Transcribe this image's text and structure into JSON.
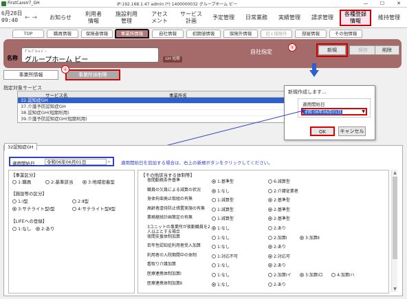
{
  "window": {
    "app_name": "FirstCareV7_GH",
    "title": "IP:192.168.1.47 admin (*) 1400000032 グループホーム ビー",
    "min": "—",
    "max": "☐",
    "close": "✕"
  },
  "topnav": {
    "date_line1": "6月28日",
    "date_line2": "09:40",
    "back": "←",
    "forward": "→",
    "items": [
      {
        "label": "お知らせ"
      },
      {
        "label": "利用者\n情報"
      },
      {
        "label": "施設利用\n管理"
      },
      {
        "label": "アセス\nメント"
      },
      {
        "label": "サービス\n計画"
      },
      {
        "label": "予定管理"
      },
      {
        "label": "日常業務"
      },
      {
        "label": "実績管理"
      },
      {
        "label": "請求管理"
      },
      {
        "label": "各種登録\n情報"
      },
      {
        "label": "維持管理"
      }
    ]
  },
  "tabs": [
    {
      "label": "TOP"
    },
    {
      "label": "職員情報"
    },
    {
      "label": "保険者情報"
    },
    {
      "label": "事業所情報"
    },
    {
      "label": "自社情報"
    },
    {
      "label": "初期値情報"
    },
    {
      "label": "保険外情報"
    },
    {
      "label": "旧↓保険外"
    },
    {
      "label": "部屋情報"
    },
    {
      "label": "その他情報"
    }
  ],
  "header": {
    "name_label": "名称",
    "kana": "ｸﾞﾙｰﾌﾟﾎｰﾑ ﾋﾞｰ",
    "facility_name": "グループホーム ビー",
    "badge": "GH 短期",
    "own_company": "自社指定",
    "new_button": "新規",
    "save_button": "保存",
    "delete_button": "削除"
  },
  "annotations": {
    "one": "①",
    "two": "②"
  },
  "subtabs": {
    "office_info": "事業所情報",
    "office_system": "事業所体制等"
  },
  "service": {
    "caption": "指定対象サービス",
    "col_service": "サービス名",
    "col_office": "事業所名",
    "rows": [
      {
        "label": "32.認知症GH"
      },
      {
        "label": "37.介護予防認知症GH"
      },
      {
        "label": "38.認知症GH(短期利用)"
      },
      {
        "label": "39.介護予防認知症GH(短期利用)"
      }
    ]
  },
  "dialog": {
    "title": "新規作成します...",
    "start_date_label": "適用開始日",
    "start_date_value": "令和 06年06月01日",
    "ok": "OK",
    "cancel": "キャンセル"
  },
  "lower": {
    "tab": "32認知症GH",
    "start_label": "適用開始日",
    "start_value": "令和06年06月01日",
    "notice": "適用開始日を追加する場合は、右上の新規ボタンをクリックしてください。",
    "region": {
      "title": "【事業区分】",
      "options": [
        "1:職員",
        "2:基準該当",
        "3:地域密着型"
      ],
      "selected": 2
    },
    "facility": {
      "title": "【施設等の区分】",
      "options": [
        "1:Ⅰ型",
        "2:Ⅱ型",
        "3:サテライト型Ⅰ型",
        "4:サテライト型Ⅱ型"
      ],
      "selected": 2
    },
    "life": {
      "title": "【LIFEへの登録】",
      "options": [
        "1:なし",
        "2:あり"
      ],
      "selected": 1
    },
    "other": {
      "title": "【その他該当する体制等】",
      "rows": [
        {
          "label": "夜間勤務条件基準",
          "opts": [
            "1:基準型",
            "6:減算型"
          ],
          "sel": 0
        },
        {
          "label": "職員の欠員による減算の状況",
          "opts": [
            "1:なし",
            "2:介護従業者"
          ],
          "sel": 0
        },
        {
          "label": "身体拘束廃止取組の有無",
          "opts": [
            "1:減算型",
            "2:基準型"
          ],
          "sel": 1
        },
        {
          "label": "高齢者虐待防止措置実施の有無",
          "opts": [
            "1:減算型",
            "2:基準型"
          ],
          "sel": 1
        },
        {
          "label": "業務継続計画策定の有無",
          "opts": [
            "1:減算型",
            "2:基準型"
          ],
          "sel": 1
        },
        {
          "label": "3ユニットの事業所が夜勤職員を2人以上とする場合",
          "opts": [
            "1:なし",
            "2:あり"
          ],
          "sel": 0
        },
        {
          "label": "夜間支援体制加算",
          "opts": [
            "1:なし",
            "2:加算Ⅰ",
            "3:加算Ⅱ"
          ],
          "sel": 2
        },
        {
          "label": "若年性認知症利用者受入加算",
          "opts": [
            "1:なし",
            "2:あり"
          ],
          "sel": 1
        },
        {
          "label": "利用者の入院期間中の体制",
          "opts": [
            "1:対応不可",
            "2:対応可"
          ],
          "sel": 1
        },
        {
          "label": "看取り介護加算",
          "opts": [
            "1:なし",
            "2:あり"
          ],
          "sel": 1
        },
        {
          "label": "医療連携体制加算Ⅰ",
          "opts": [
            "1:なし",
            "2:加算Ⅰイ",
            "3:加算Ⅰロ",
            "4:加算Ⅰハ"
          ],
          "sel": 2
        },
        {
          "label": "医療連携体制加算Ⅱ",
          "opts": [
            "1:なし",
            "2:あり"
          ],
          "sel": 0
        }
      ]
    }
  }
}
